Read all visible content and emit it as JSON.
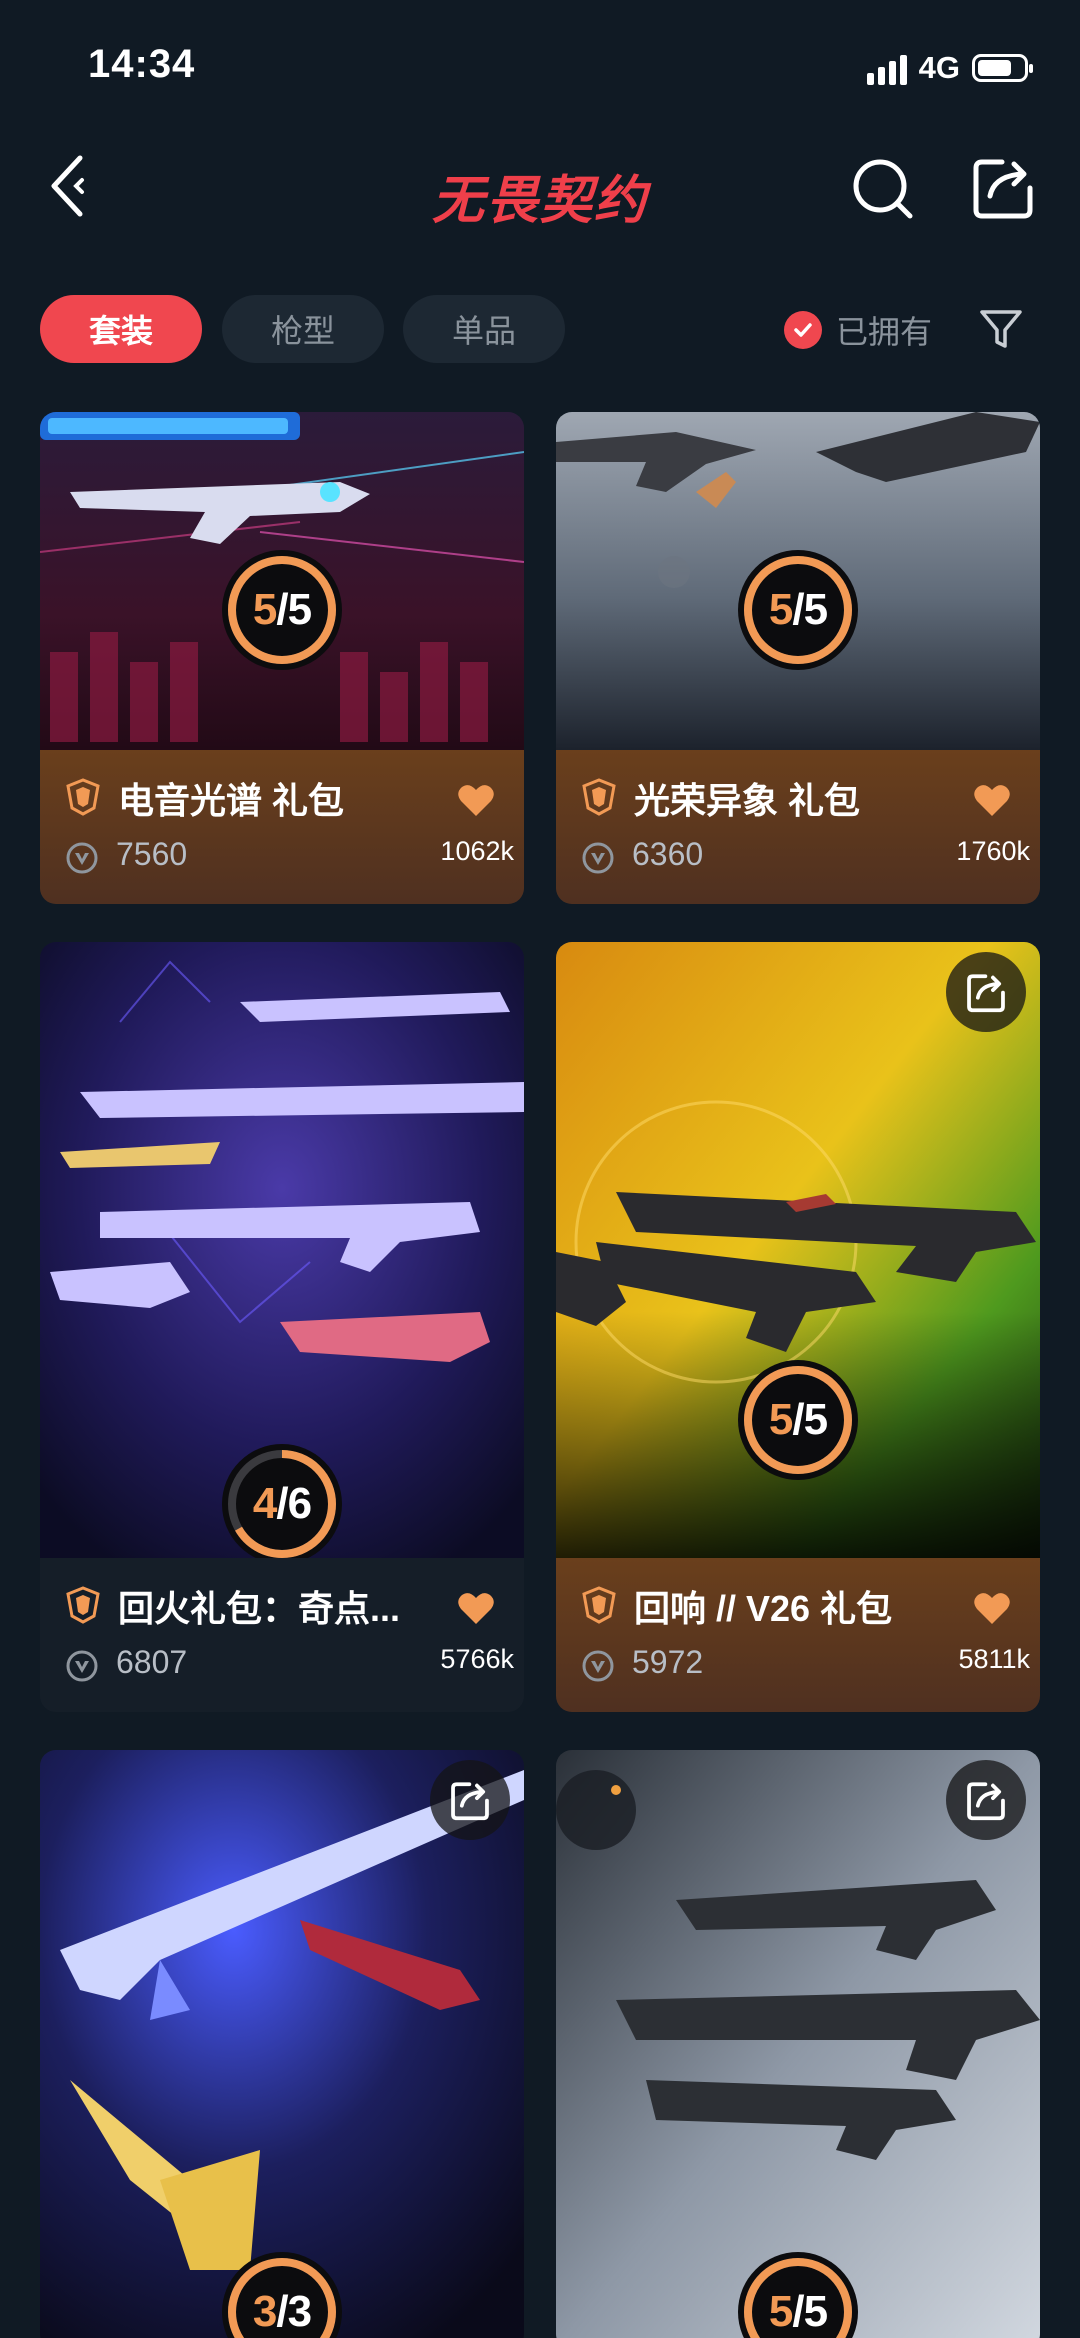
{
  "status_bar": {
    "time": "14:34",
    "network": "4G"
  },
  "nav": {
    "logo_text": "无畏契约"
  },
  "filters": {
    "tabs": [
      {
        "label": "套装",
        "active": true
      },
      {
        "label": "枪型",
        "active": false
      },
      {
        "label": "单品",
        "active": false
      }
    ],
    "owned_label": "已拥有",
    "owned_checked": true
  },
  "cards": [
    {
      "name": "电音光谱 礼包",
      "price": "7560",
      "likes": "1062k",
      "owned": 5,
      "total": 5,
      "progress_text_owned": "5",
      "progress_text_total": "/5",
      "theme": "orange",
      "has_share": false
    },
    {
      "name": "光荣异象 礼包",
      "price": "6360",
      "likes": "1760k",
      "owned": 5,
      "total": 5,
      "progress_text_owned": "5",
      "progress_text_total": "/5",
      "theme": "orange",
      "has_share": false
    },
    {
      "name": "回火礼包：奇点...",
      "price": "6807",
      "likes": "5766k",
      "owned": 4,
      "total": 6,
      "progress_text_owned": "4",
      "progress_text_total": "/6",
      "theme": "dark",
      "has_share": false
    },
    {
      "name": "回响 // V26 礼包",
      "price": "5972",
      "likes": "5811k",
      "owned": 5,
      "total": 5,
      "progress_text_owned": "5",
      "progress_text_total": "/5",
      "theme": "orange",
      "has_share": true
    },
    {
      "name": "",
      "price": "",
      "likes": "",
      "owned": 3,
      "total": 3,
      "progress_text_owned": "3",
      "progress_text_total": "/3",
      "theme": "dark",
      "has_share": true
    },
    {
      "name": "",
      "price": "",
      "likes": "",
      "owned": 5,
      "total": 5,
      "progress_text_owned": "5",
      "progress_text_total": "/5",
      "theme": "dark",
      "has_share": true
    }
  ],
  "colors": {
    "accent": "#f0474f",
    "progress": "#f29a55",
    "background": "#101a24"
  }
}
